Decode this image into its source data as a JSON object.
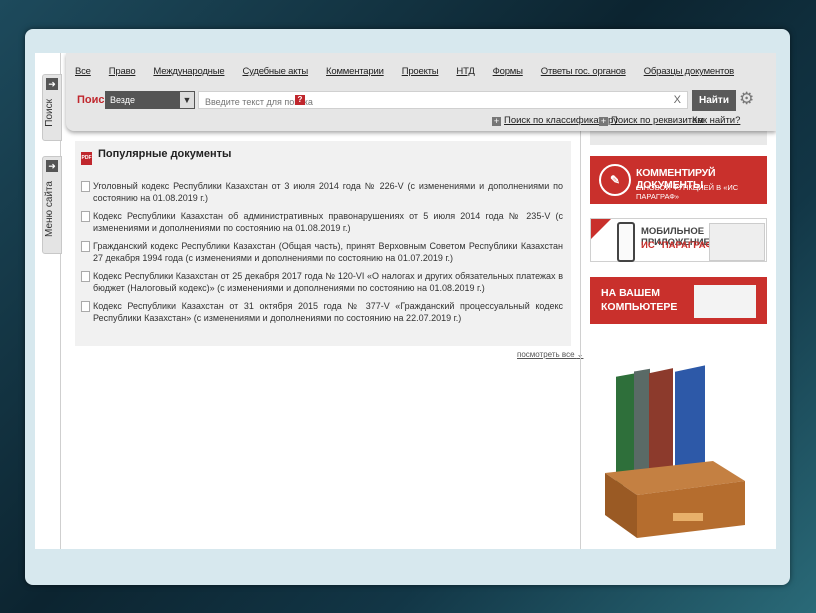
{
  "nav": {
    "links": [
      "Все",
      "Право",
      "Международные",
      "Судебные акты",
      "Комментарии",
      "Проекты",
      "НТД",
      "Формы",
      "Ответы гос. органов",
      "Образцы документов"
    ]
  },
  "search": {
    "label": "Поиск",
    "scope": "Везде",
    "placeholder": "Введите текст для поиска",
    "help": "?",
    "clear": "X",
    "button": "Найти",
    "by_classifier": "Поиск по классификатору",
    "by_requisites": "Поиск по реквизитам",
    "how_to": "Как найти?"
  },
  "side_tabs": {
    "search": "Поиск",
    "menu": "Меню сайта"
  },
  "popular": {
    "title": "Популярные документы",
    "pdf_icon": "PDF",
    "documents": [
      "Уголовный кодекс Республики Казахстан от 3 июля 2014 года № 226-V (с изменениями и дополнениями по состоянию на 01.08.2019 г.)",
      "Кодекс Республики Казахстан об административных правонарушениях от 5 июля 2014 года № 235-V (с изменениями и дополнениями по состоянию на 01.08.2019 г.)",
      "Гражданский кодекс Республики Казахстан (Общая часть), принят Верховным Советом Республики Казахстан 27 декабря 1994 года (с изменениями и дополнениями по состоянию на 01.07.2019 г.)",
      "Кодекс Республики Казахстан от 25 декабря 2017 года № 120-VI «О налогах и других обязательных платежах в бюджет (Налоговый кодекс)» (с изменениями и дополнениями по состоянию на 01.08.2019 г.)",
      "Кодекс Республики Казахстан от 31 октября 2015 года № 377-V «Гражданский процессуальный кодекс Республики Казахстан» (с изменениями и дополнениями по состоянию на 22.07.2019 г.)"
    ],
    "see_all": "посмотреть все"
  },
  "banners": {
    "comment_title": "КОММЕНТИРУЙ ДОКУМЕНТЫ",
    "comment_sub": "С НОВОЙ ФУНКЦИЕЙ В «ИС ПАРАГРАФ»",
    "mobile_title": "МОБИЛЬНОЕ ПРИЛОЖЕНИЕ",
    "mobile_sub": "ИС \"ПАРАГРАФ\"  »",
    "computer_title_1": "НА ВАШЕМ",
    "computer_title_2": "КОМПЬЮТЕРЕ"
  },
  "colors": {
    "brand_red": "#c9302c",
    "panel_gray": "#e6e6e6"
  }
}
